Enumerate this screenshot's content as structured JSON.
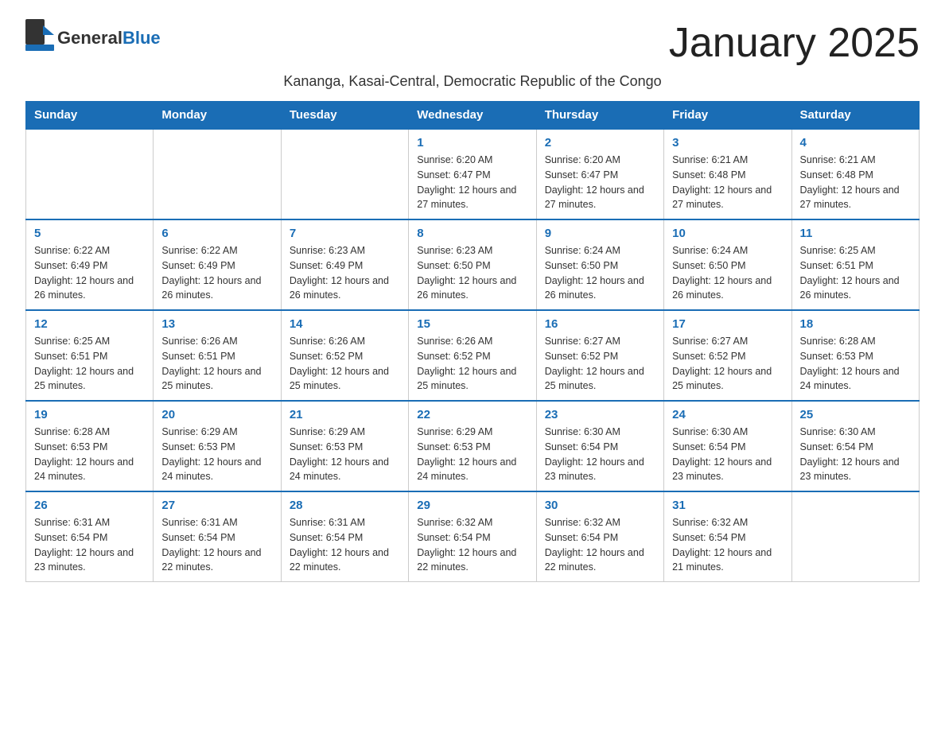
{
  "header": {
    "logo_general": "General",
    "logo_blue": "Blue",
    "month_title": "January 2025",
    "subtitle": "Kananga, Kasai-Central, Democratic Republic of the Congo"
  },
  "weekdays": [
    "Sunday",
    "Monday",
    "Tuesday",
    "Wednesday",
    "Thursday",
    "Friday",
    "Saturday"
  ],
  "weeks": [
    [
      {
        "day": "",
        "info": ""
      },
      {
        "day": "",
        "info": ""
      },
      {
        "day": "",
        "info": ""
      },
      {
        "day": "1",
        "info": "Sunrise: 6:20 AM\nSunset: 6:47 PM\nDaylight: 12 hours and 27 minutes."
      },
      {
        "day": "2",
        "info": "Sunrise: 6:20 AM\nSunset: 6:47 PM\nDaylight: 12 hours and 27 minutes."
      },
      {
        "day": "3",
        "info": "Sunrise: 6:21 AM\nSunset: 6:48 PM\nDaylight: 12 hours and 27 minutes."
      },
      {
        "day": "4",
        "info": "Sunrise: 6:21 AM\nSunset: 6:48 PM\nDaylight: 12 hours and 27 minutes."
      }
    ],
    [
      {
        "day": "5",
        "info": "Sunrise: 6:22 AM\nSunset: 6:49 PM\nDaylight: 12 hours and 26 minutes."
      },
      {
        "day": "6",
        "info": "Sunrise: 6:22 AM\nSunset: 6:49 PM\nDaylight: 12 hours and 26 minutes."
      },
      {
        "day": "7",
        "info": "Sunrise: 6:23 AM\nSunset: 6:49 PM\nDaylight: 12 hours and 26 minutes."
      },
      {
        "day": "8",
        "info": "Sunrise: 6:23 AM\nSunset: 6:50 PM\nDaylight: 12 hours and 26 minutes."
      },
      {
        "day": "9",
        "info": "Sunrise: 6:24 AM\nSunset: 6:50 PM\nDaylight: 12 hours and 26 minutes."
      },
      {
        "day": "10",
        "info": "Sunrise: 6:24 AM\nSunset: 6:50 PM\nDaylight: 12 hours and 26 minutes."
      },
      {
        "day": "11",
        "info": "Sunrise: 6:25 AM\nSunset: 6:51 PM\nDaylight: 12 hours and 26 minutes."
      }
    ],
    [
      {
        "day": "12",
        "info": "Sunrise: 6:25 AM\nSunset: 6:51 PM\nDaylight: 12 hours and 25 minutes."
      },
      {
        "day": "13",
        "info": "Sunrise: 6:26 AM\nSunset: 6:51 PM\nDaylight: 12 hours and 25 minutes."
      },
      {
        "day": "14",
        "info": "Sunrise: 6:26 AM\nSunset: 6:52 PM\nDaylight: 12 hours and 25 minutes."
      },
      {
        "day": "15",
        "info": "Sunrise: 6:26 AM\nSunset: 6:52 PM\nDaylight: 12 hours and 25 minutes."
      },
      {
        "day": "16",
        "info": "Sunrise: 6:27 AM\nSunset: 6:52 PM\nDaylight: 12 hours and 25 minutes."
      },
      {
        "day": "17",
        "info": "Sunrise: 6:27 AM\nSunset: 6:52 PM\nDaylight: 12 hours and 25 minutes."
      },
      {
        "day": "18",
        "info": "Sunrise: 6:28 AM\nSunset: 6:53 PM\nDaylight: 12 hours and 24 minutes."
      }
    ],
    [
      {
        "day": "19",
        "info": "Sunrise: 6:28 AM\nSunset: 6:53 PM\nDaylight: 12 hours and 24 minutes."
      },
      {
        "day": "20",
        "info": "Sunrise: 6:29 AM\nSunset: 6:53 PM\nDaylight: 12 hours and 24 minutes."
      },
      {
        "day": "21",
        "info": "Sunrise: 6:29 AM\nSunset: 6:53 PM\nDaylight: 12 hours and 24 minutes."
      },
      {
        "day": "22",
        "info": "Sunrise: 6:29 AM\nSunset: 6:53 PM\nDaylight: 12 hours and 24 minutes."
      },
      {
        "day": "23",
        "info": "Sunrise: 6:30 AM\nSunset: 6:54 PM\nDaylight: 12 hours and 23 minutes."
      },
      {
        "day": "24",
        "info": "Sunrise: 6:30 AM\nSunset: 6:54 PM\nDaylight: 12 hours and 23 minutes."
      },
      {
        "day": "25",
        "info": "Sunrise: 6:30 AM\nSunset: 6:54 PM\nDaylight: 12 hours and 23 minutes."
      }
    ],
    [
      {
        "day": "26",
        "info": "Sunrise: 6:31 AM\nSunset: 6:54 PM\nDaylight: 12 hours and 23 minutes."
      },
      {
        "day": "27",
        "info": "Sunrise: 6:31 AM\nSunset: 6:54 PM\nDaylight: 12 hours and 22 minutes."
      },
      {
        "day": "28",
        "info": "Sunrise: 6:31 AM\nSunset: 6:54 PM\nDaylight: 12 hours and 22 minutes."
      },
      {
        "day": "29",
        "info": "Sunrise: 6:32 AM\nSunset: 6:54 PM\nDaylight: 12 hours and 22 minutes."
      },
      {
        "day": "30",
        "info": "Sunrise: 6:32 AM\nSunset: 6:54 PM\nDaylight: 12 hours and 22 minutes."
      },
      {
        "day": "31",
        "info": "Sunrise: 6:32 AM\nSunset: 6:54 PM\nDaylight: 12 hours and 21 minutes."
      },
      {
        "day": "",
        "info": ""
      }
    ]
  ]
}
